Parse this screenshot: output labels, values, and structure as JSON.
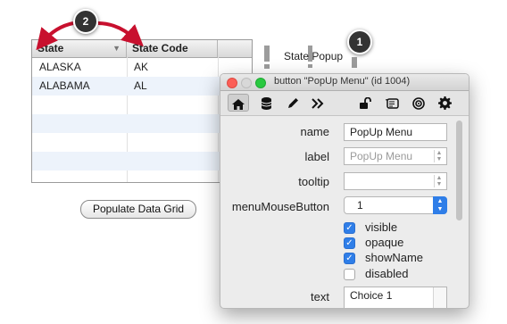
{
  "grid": {
    "columns": [
      "State",
      "State Code"
    ],
    "rows": [
      [
        "ALASKA",
        "AK"
      ],
      [
        "ALABAMA",
        "AL"
      ],
      [
        "",
        ""
      ],
      [
        "",
        ""
      ],
      [
        "",
        ""
      ],
      [
        "",
        ""
      ]
    ],
    "sort_icon": "triangle-down-icon"
  },
  "populate_button": "Populate Data Grid",
  "callouts": [
    "2",
    "1"
  ],
  "popup": {
    "label": "State Popup"
  },
  "inspector": {
    "title": "button \"PopUp Menu\" (id 1004)",
    "toolbar": [
      "home-icon",
      "database-icon",
      "pencil-icon",
      "double-chevron-icon",
      "lock-icon",
      "script-icon",
      "target-icon",
      "gear-icon"
    ],
    "props": {
      "name_label": "name",
      "name_value": "PopUp Menu",
      "label_label": "label",
      "label_placeholder": "PopUp Menu",
      "tooltip_label": "tooltip",
      "tooltip_value": "",
      "mmb_label": "menuMouseButton",
      "mmb_value": "1",
      "visible_label": "visible",
      "visible": true,
      "opaque_label": "opaque",
      "opaque": true,
      "showname_label": "showName",
      "showname": true,
      "disabled_label": "disabled",
      "disabled": false,
      "text_label": "text",
      "text_value": "Choice 1"
    }
  },
  "colors": {
    "accent": "#2f7ee8",
    "arrow": "#c8102e",
    "close": "#fc5f57",
    "minimize": "#d8d8d8",
    "zoom": "#29c940"
  }
}
